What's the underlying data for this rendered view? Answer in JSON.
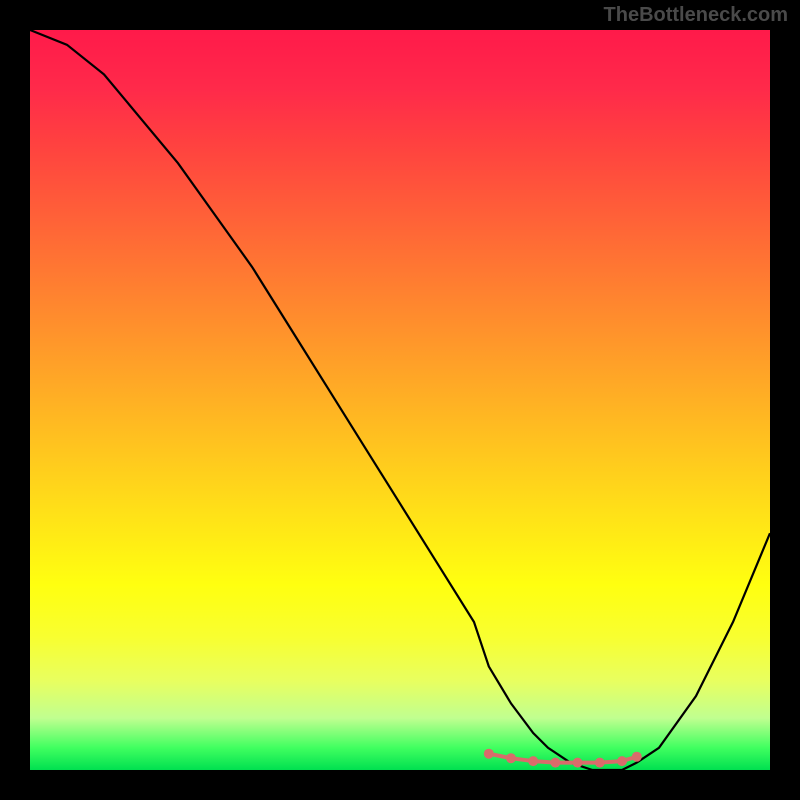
{
  "watermark": "TheBottleneck.com",
  "chart_data": {
    "type": "line",
    "title": "",
    "xlabel": "",
    "ylabel": "",
    "xlim": [
      0,
      100
    ],
    "ylim": [
      0,
      100
    ],
    "series": [
      {
        "name": "bottleneck-curve",
        "x": [
          0,
          5,
          10,
          15,
          20,
          25,
          30,
          35,
          40,
          45,
          50,
          55,
          60,
          62,
          65,
          68,
          70,
          73,
          76,
          80,
          82,
          85,
          90,
          95,
          100
        ],
        "y": [
          100,
          98,
          94,
          88,
          82,
          75,
          68,
          60,
          52,
          44,
          36,
          28,
          20,
          14,
          9,
          5,
          3,
          1,
          0,
          0,
          1,
          3,
          10,
          20,
          32
        ]
      },
      {
        "name": "optimal-markers",
        "x": [
          62,
          65,
          68,
          71,
          74,
          77,
          80,
          82
        ],
        "y": [
          2.2,
          1.6,
          1.2,
          1.0,
          1.0,
          1.0,
          1.2,
          1.8
        ]
      }
    ],
    "gradient_stops": [
      {
        "pos": 0,
        "color": "#ff1a4a"
      },
      {
        "pos": 50,
        "color": "#ffc020"
      },
      {
        "pos": 75,
        "color": "#ffff10"
      },
      {
        "pos": 100,
        "color": "#00e050"
      }
    ]
  }
}
